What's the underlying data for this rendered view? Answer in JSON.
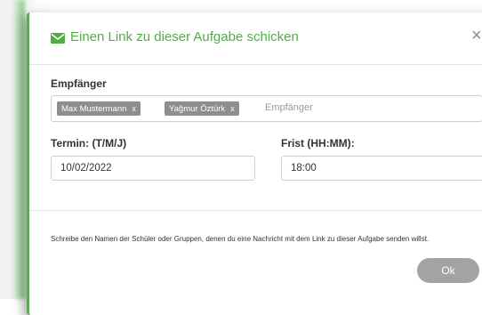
{
  "dialog": {
    "title": "Einen Link zu dieser Aufgabe schicken",
    "title_icon": "envelope-icon",
    "close_symbol": "×",
    "accent_color": "#4fae46"
  },
  "recipients": {
    "label": "Empfänger",
    "tags": [
      {
        "name": "Max Mustermann",
        "remove": "x"
      },
      {
        "name": "Yağmur Öztürk",
        "remove": "x"
      }
    ],
    "placeholder": "Empfänger"
  },
  "date": {
    "label": "Termin: (T/M/J)",
    "value": "10/02/2022"
  },
  "deadline": {
    "label": "Frist (HH:MM):",
    "value": "18:00"
  },
  "info": {
    "text": "Schreibe den Namen der Schüler oder Gruppen, denen du eine Nachricht mit dem Link zu dieser Aufgabe senden willst."
  },
  "actions": {
    "ok_label": "Ok",
    "ok_color": "#a3a3a3"
  }
}
